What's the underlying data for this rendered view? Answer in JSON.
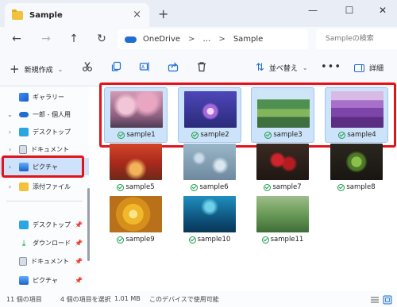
{
  "window": {
    "tab_title": "Sample",
    "tab_close": "×",
    "new_tab": "+",
    "minimize": "—",
    "maximize": "☐",
    "close": "✕"
  },
  "nav": {
    "back": "←",
    "forward": "→",
    "up": "↑",
    "refresh": "↻",
    "breadcrumb": [
      "OneDrive",
      "…",
      "Sample"
    ],
    "separator": ">",
    "search_placeholder": "Sampleの検索"
  },
  "toolbar": {
    "new_label": "新規作成",
    "new_icon": "+",
    "chevron": "⌄",
    "cut_icon": "scissors-icon",
    "copy_icon": "copy-icon",
    "rename_icon": "rename-icon",
    "share_icon": "share-icon",
    "delete_icon": "trash-icon",
    "sort_label": "並べ替え",
    "sort_icon": "⇅",
    "more": "•••",
    "details_label": "詳細"
  },
  "sidebar": {
    "items": [
      {
        "label": "ギャラリー",
        "icon": "gallery-icon",
        "expander": ""
      },
      {
        "label": "一郎 - 個人用",
        "icon": "onedrive-icon",
        "expander": "⌄"
      },
      {
        "label": "デスクトップ",
        "icon": "desktop-icon",
        "expander": "›"
      },
      {
        "label": "ドキュメント",
        "icon": "document-icon",
        "expander": "›"
      },
      {
        "label": "ピクチャ",
        "icon": "pictures-icon",
        "expander": "›"
      },
      {
        "label": "添付ファイル",
        "icon": "folder-icon",
        "expander": "›"
      }
    ],
    "pinned": [
      {
        "label": "デスクトップ",
        "icon": "desktop-icon",
        "pin": "📌"
      },
      {
        "label": "ダウンロード",
        "icon": "download-icon",
        "pin": "📌"
      },
      {
        "label": "ドキュメント",
        "icon": "document-icon",
        "pin": "📌"
      },
      {
        "label": "ピクチャ",
        "icon": "pictures-icon",
        "pin": "📌"
      }
    ]
  },
  "files": [
    {
      "name": "sample1",
      "selected": true
    },
    {
      "name": "sample2",
      "selected": true
    },
    {
      "name": "sample3",
      "selected": true
    },
    {
      "name": "sample4",
      "selected": true
    },
    {
      "name": "sample5",
      "selected": false
    },
    {
      "name": "sample6",
      "selected": false
    },
    {
      "name": "sample7",
      "selected": false
    },
    {
      "name": "sample8",
      "selected": false
    },
    {
      "name": "sample9",
      "selected": false
    },
    {
      "name": "sample10",
      "selected": false
    },
    {
      "name": "sample11",
      "selected": false
    }
  ],
  "status": {
    "item_count": "11 個の項目",
    "selection": "4 個の項目を選択",
    "size": "1.01 MB",
    "availability": "このデバイスで使用可能"
  },
  "colors": {
    "accent": "#1f6fd1",
    "selection": "#cce3f9",
    "highlight_box": "#e0141a",
    "sync_check": "#1a9e4b"
  }
}
